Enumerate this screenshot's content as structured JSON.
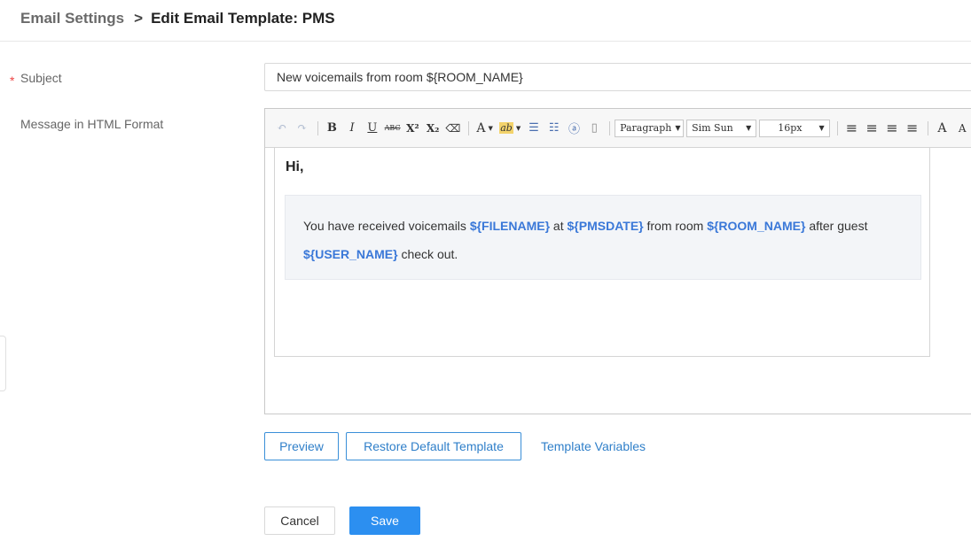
{
  "breadcrumb": {
    "parent": "Email Settings",
    "separator": ">",
    "current": "Edit Email Template: PMS"
  },
  "form": {
    "required_mark": "*",
    "subject_label": "Subject",
    "subject_value": "New voicemails from room ${ROOM_NAME}",
    "message_label": "Message in HTML Format"
  },
  "side_tab": {
    "glyph": "<"
  },
  "toolbar": {
    "buttons": {
      "undo": "↶",
      "redo": "↷",
      "bold": "B",
      "italic": "I",
      "underline": "U",
      "strikethrough": "ABC",
      "superscript": "X²",
      "subscript": "X₂",
      "eraser": "⌫",
      "font_color": "A",
      "highlight": "ab",
      "ordered_list": "☰",
      "unordered_list": "☷",
      "anchor": "ⓐ",
      "page": "▯",
      "align_left": "≡",
      "align_center": "≡",
      "align_right": "≡",
      "align_justify": "≡",
      "font_increase": "A",
      "font_decrease": "A"
    },
    "paragraph_select": "Paragraph",
    "font_select": "Sim Sun",
    "size_select": "16px",
    "dropdown_arrow": "▼"
  },
  "editor_content": {
    "greeting": "Hi,",
    "text_1": "You have received voicemails ",
    "var_filename": "${FILENAME}",
    "text_2": " at ",
    "var_pmsdate": "${PMSDATE}",
    "text_3": " from room ",
    "var_room_name": "${ROOM_NAME}",
    "text_4": " after guest ",
    "var_user_name": "${USER_NAME}",
    "text_5": " check out."
  },
  "actions": {
    "preview": "Preview",
    "restore": "Restore Default Template",
    "variables": "Template Variables",
    "cancel": "Cancel",
    "save": "Save"
  },
  "colors": {
    "accent": "#2c8ff0",
    "variable": "#3a78d8",
    "required": "#e44444"
  }
}
